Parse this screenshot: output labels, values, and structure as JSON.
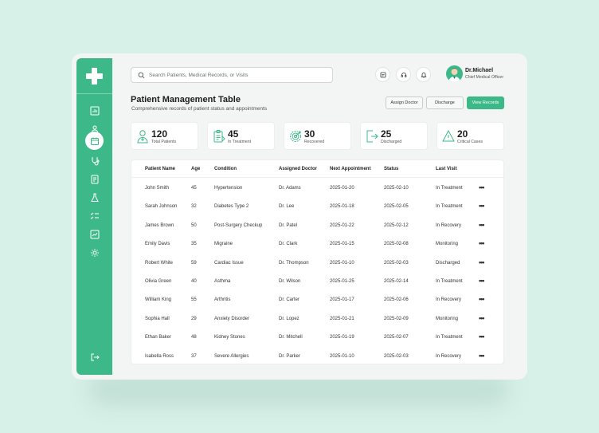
{
  "search": {
    "placeholder": "Search Patients, Medical Records, or Visits"
  },
  "user": {
    "name": "Dr.Michael",
    "role": "Chief Medical Officer"
  },
  "page": {
    "title": "Patient Management Table",
    "subtitle": "Comprehensive records of patient status and appointments"
  },
  "actions": {
    "assign": "Assign Doctor",
    "discharge": "Discharge",
    "view": "View Records"
  },
  "stats": [
    {
      "value": "120",
      "label": "Total Patients",
      "icon": "patient-icon"
    },
    {
      "value": "45",
      "label": "In Treatment",
      "icon": "clipboard-icon"
    },
    {
      "value": "30",
      "label": "Recovered",
      "icon": "target-icon"
    },
    {
      "value": "25",
      "label": "Discharged",
      "icon": "exit-icon"
    },
    {
      "value": "20",
      "label": "Critical Cases",
      "icon": "warning-icon"
    }
  ],
  "table": {
    "columns": [
      "Patient Name",
      "Age",
      "Condition",
      "Assigned Doctor",
      "Next Appointment",
      "Status",
      "Last Visit"
    ],
    "rows": [
      [
        "John Smith",
        "45",
        "Hypertension",
        "Dr. Adams",
        "2025-01-20",
        "2025-02-10",
        "In Treatment"
      ],
      [
        "Sarah Johnson",
        "32",
        "Diabetes Type 2",
        "Dr. Lee",
        "2025-01-18",
        "2025-02-05",
        "In Treatment"
      ],
      [
        "James Brown",
        "50",
        "Post-Surgery Checkup",
        "Dr. Patel",
        "2025-01-22",
        "2025-02-12",
        "In Recovery"
      ],
      [
        "Emily Davis",
        "35",
        "Migraine",
        "Dr. Clark",
        "2025-01-15",
        "2025-02-08",
        "Monitoring"
      ],
      [
        "Robert White",
        "59",
        "Cardiac Issue",
        "Dr. Thompson",
        "2025-01-10",
        "2025-02-03",
        "Discharged"
      ],
      [
        "Olivia Green",
        "40",
        "Asthma",
        "Dr. Wilson",
        "2025-01-25",
        "2025-02-14",
        "In Treatment"
      ],
      [
        "William King",
        "55",
        "Arthritis",
        "Dr. Carter",
        "2025-01-17",
        "2025-02-06",
        "In Recovery"
      ],
      [
        "Sophia Hall",
        "29",
        "Anxiety Disorder",
        "Dr. Lopez",
        "2025-01-21",
        "2025-02-09",
        "Monitoring"
      ],
      [
        "Ethan Baker",
        "48",
        "Kidney Stones",
        "Dr. Mitchell",
        "2025-01-19",
        "2025-02-07",
        "In Treatment"
      ],
      [
        "Isabella Ross",
        "37",
        "Severe Allergies",
        "Dr. Parker",
        "2025-01-10",
        "2025-02-03",
        "In Recovery"
      ]
    ],
    "more_label": "•••"
  },
  "colors": {
    "accent": "#3db888",
    "background": "#d8f1e8"
  }
}
